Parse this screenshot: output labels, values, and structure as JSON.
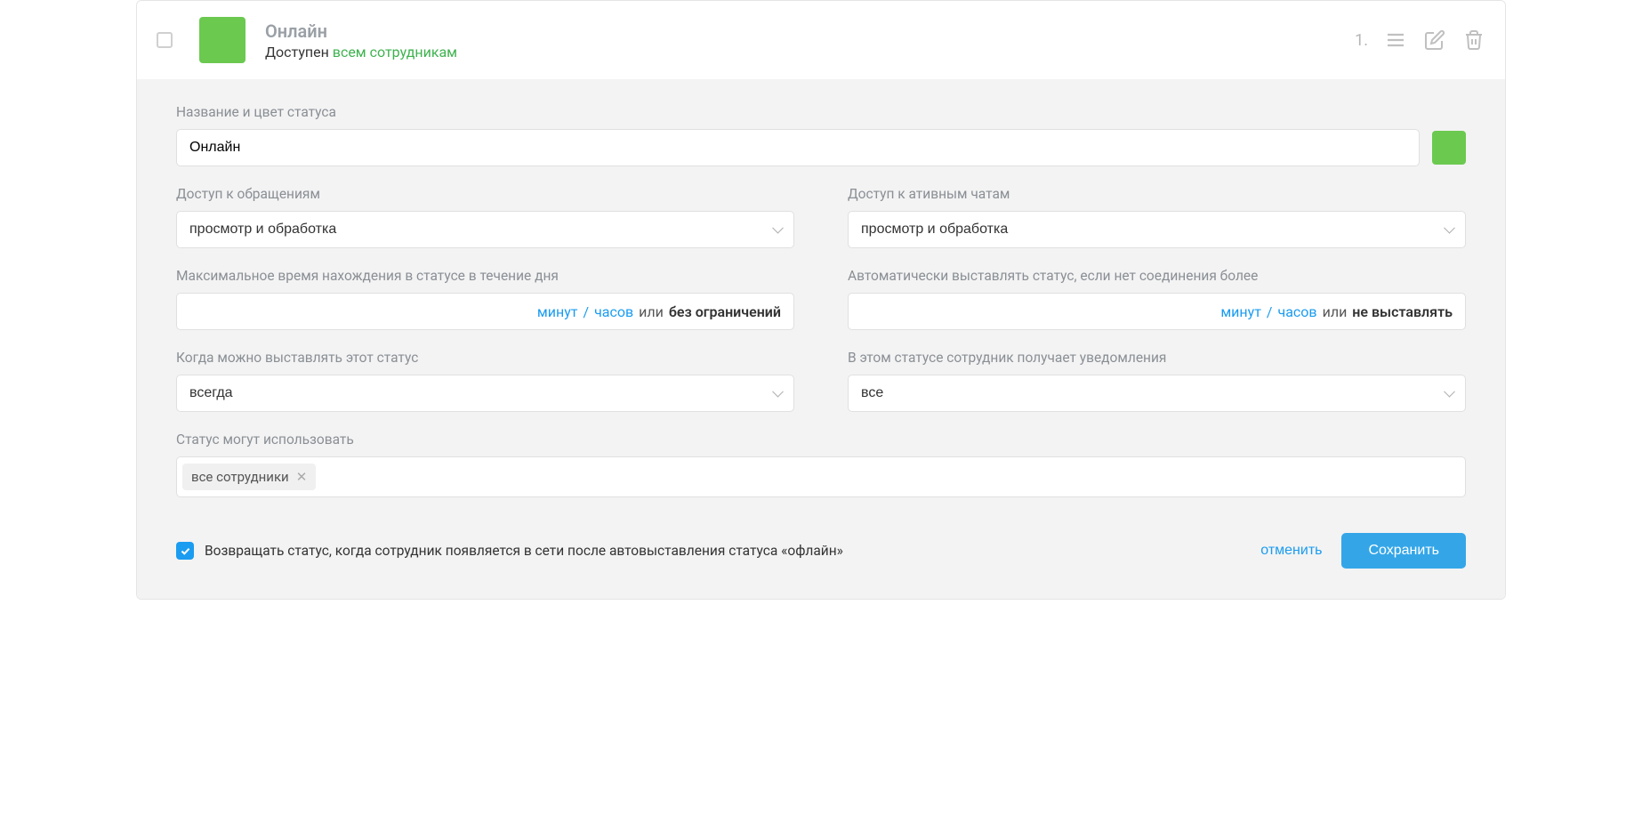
{
  "header": {
    "title": "Онлайн",
    "sub_prefix": "Доступен ",
    "sub_link": "всем сотрудникам",
    "order": "1."
  },
  "form": {
    "name_label": "Название и цвет статуса",
    "name_value": "Онлайн",
    "color": "#6bc950",
    "access_requests": {
      "label": "Доступ к обращениям",
      "value": "просмотр и обработка"
    },
    "access_chats": {
      "label": "Доступ к ативным чатам",
      "value": "просмотр и обработка"
    },
    "max_time": {
      "label": "Максимальное время нахождения в статусе в течение дня",
      "minutes": "минут",
      "hours": "часов",
      "or": "или",
      "bold": "без ограничений"
    },
    "auto_offline": {
      "label": "Автоматически выставлять статус, если нет соединения более",
      "minutes": "минут",
      "hours": "часов",
      "or": "или",
      "bold": "не выставлять"
    },
    "when": {
      "label": "Когда можно выставлять этот статус",
      "value": "всегда"
    },
    "notifications": {
      "label": "В этом статусе сотрудник получает уведомления",
      "value": "все"
    },
    "who": {
      "label": "Статус могут использовать",
      "tag": "все сотрудники"
    },
    "return_checkbox": "Возвращать статус, когда сотрудник появляется в сети после автовыставления статуса «офлайн»",
    "cancel": "отменить",
    "save": "Сохранить"
  }
}
